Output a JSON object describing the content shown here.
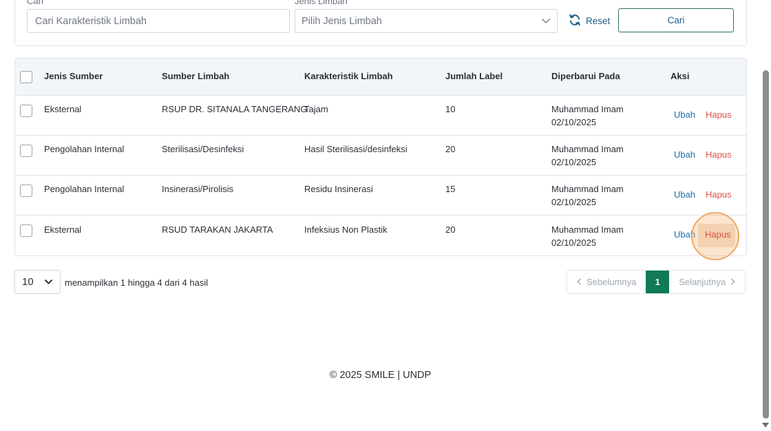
{
  "filters": {
    "search_label": "Cari",
    "search_placeholder": "Cari Karakteristik Limbah",
    "type_label": "Jenis Limbah",
    "type_placeholder": "Pilih Jenis Limbah",
    "reset_label": "Reset",
    "submit_label": "Cari"
  },
  "table": {
    "headers": [
      "Jenis Sumber",
      "Sumber Limbah",
      "Karakteristik Limbah",
      "Jumlah Label",
      "Diperbarui Pada",
      "Aksi"
    ],
    "rows": [
      {
        "jenis_sumber": "Eksternal",
        "sumber_limbah": "RSUP DR. SITANALA TANGERANG",
        "karakteristik": "Tajam",
        "jumlah": "10",
        "diperbarui_oleh": "Muhammad Imam",
        "diperbarui_tanggal": "02/10/2025",
        "edit": "Ubah",
        "delete": "Hapus"
      },
      {
        "jenis_sumber": "Pengolahan Internal",
        "sumber_limbah": "Sterilisasi/Desinfeksi",
        "karakteristik": "Hasil Sterilisasi/desinfeksi",
        "jumlah": "20",
        "diperbarui_oleh": "Muhammad Imam",
        "diperbarui_tanggal": "02/10/2025",
        "edit": "Ubah",
        "delete": "Hapus"
      },
      {
        "jenis_sumber": "Pengolahan Internal",
        "sumber_limbah": "Insinerasi/Pirolisis",
        "karakteristik": "Residu Insinerasi",
        "jumlah": "15",
        "diperbarui_oleh": "Muhammad Imam",
        "diperbarui_tanggal": "02/10/2025",
        "edit": "Ubah",
        "delete": "Hapus"
      },
      {
        "jenis_sumber": "Eksternal",
        "sumber_limbah": "RSUD TARAKAN JAKARTA",
        "karakteristik": "Infeksius Non Plastik",
        "jumlah": "20",
        "diperbarui_oleh": "Muhammad Imam",
        "diperbarui_tanggal": "02/10/2025",
        "edit": "Ubah",
        "delete": "Hapus"
      }
    ]
  },
  "pagination": {
    "page_size": "10",
    "summary": "menampilkan 1 hingga 4 dari 4 hasil",
    "prev_label": "Sebelumnya",
    "current_page": "1",
    "next_label": "Selanjutnya"
  },
  "footer": {
    "text": "© 2025 SMILE | UNDP"
  },
  "colors": {
    "accent_green": "#0f7a55",
    "link_blue": "#1f6fa8",
    "danger_red": "#d9534f",
    "highlight": "#f0a860"
  }
}
